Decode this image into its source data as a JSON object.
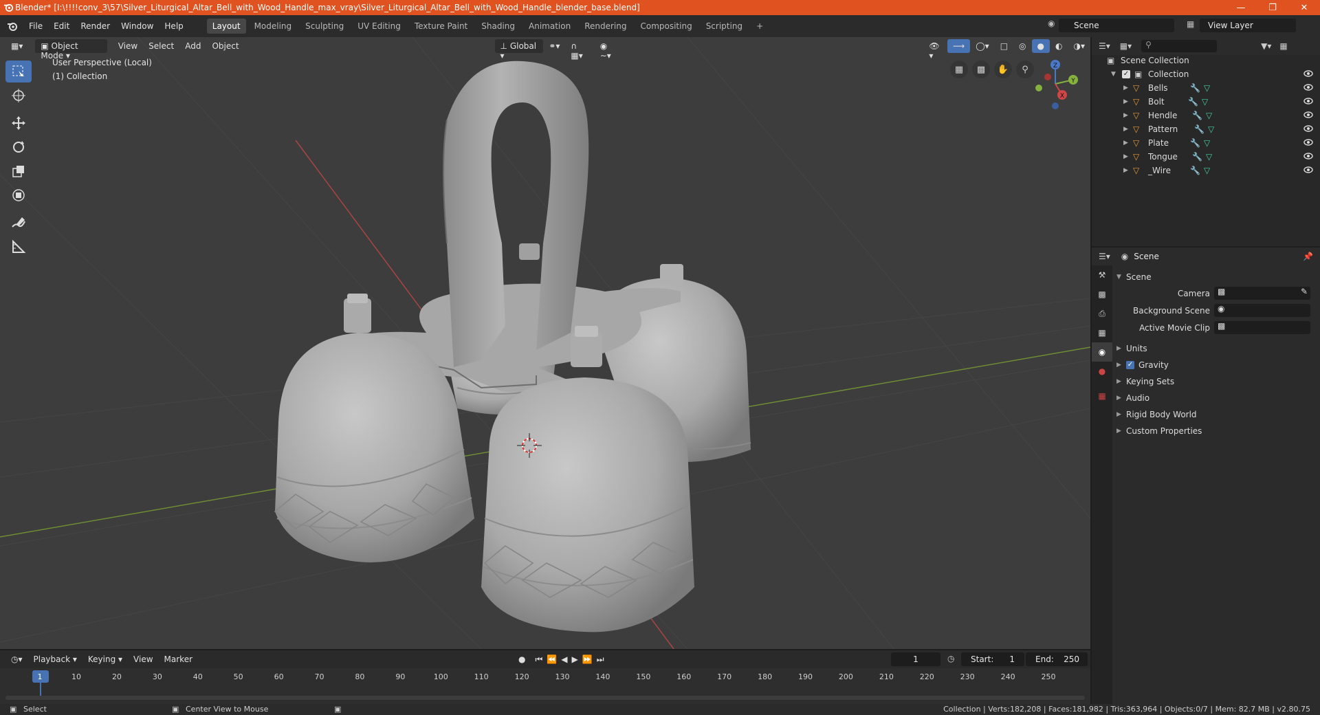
{
  "window": {
    "title": "Blender* [I:\\!!!!conv_3\\57\\Silver_Liturgical_Altar_Bell_with_Wood_Handle_max_vray\\Silver_Liturgical_Altar_Bell_with_Wood_Handle_blender_base.blend]",
    "controls": [
      "minimize-icon",
      "restore-icon",
      "close-icon"
    ]
  },
  "menu": [
    "File",
    "Edit",
    "Render",
    "Window",
    "Help"
  ],
  "workspaces": [
    "Layout",
    "Modeling",
    "Sculpting",
    "UV Editing",
    "Texture Paint",
    "Shading",
    "Animation",
    "Rendering",
    "Compositing",
    "Scripting"
  ],
  "active_workspace": "Layout",
  "scene_name": "Scene",
  "view_layer": "View Layer",
  "viewport": {
    "mode": "Object Mode",
    "menus": [
      "View",
      "Select",
      "Add",
      "Object"
    ],
    "orientation": "Global",
    "info_line1": "User Perspective (Local)",
    "info_line2": "(1) Collection",
    "gizmo_axes": [
      "Z",
      "Y",
      "X"
    ]
  },
  "outliner": {
    "root": "Scene Collection",
    "collection": "Collection",
    "objects": [
      "Bells",
      "Bolt",
      "Hendle",
      "Pattern",
      "Plate",
      "Tongue",
      "_Wire"
    ]
  },
  "properties": {
    "context": "Scene",
    "section": "Scene",
    "fields": [
      {
        "label": "Camera",
        "value": ""
      },
      {
        "label": "Background Scene",
        "value": ""
      },
      {
        "label": "Active Movie Clip",
        "value": ""
      }
    ],
    "panels": [
      "Units",
      "Gravity",
      "Keying Sets",
      "Audio",
      "Rigid Body World",
      "Custom Properties"
    ],
    "gravity_checked": true
  },
  "timeline": {
    "menus": [
      "Playback",
      "Keying",
      "View",
      "Marker"
    ],
    "current_frame": "1",
    "start_label": "Start:",
    "start": "1",
    "end_label": "End:",
    "end": "250",
    "ticks": [
      "1",
      "10",
      "20",
      "30",
      "40",
      "50",
      "60",
      "70",
      "80",
      "90",
      "100",
      "110",
      "120",
      "130",
      "140",
      "150",
      "160",
      "170",
      "180",
      "190",
      "200",
      "210",
      "220",
      "230",
      "240",
      "250"
    ]
  },
  "status": {
    "left": "Select",
    "middle": "Center View to Mouse",
    "right": "Collection | Verts:182,208 | Faces:181,982 | Tris:363,964 | Objects:0/7 | Mem: 82.7 MB | v2.80.75"
  },
  "colors": {
    "title_bar": "#e0521f",
    "accent": "#4772b3",
    "viewport_bg": "#3d3d3d",
    "axis_x": "#c44a4a",
    "axis_y": "#7ea33a"
  }
}
